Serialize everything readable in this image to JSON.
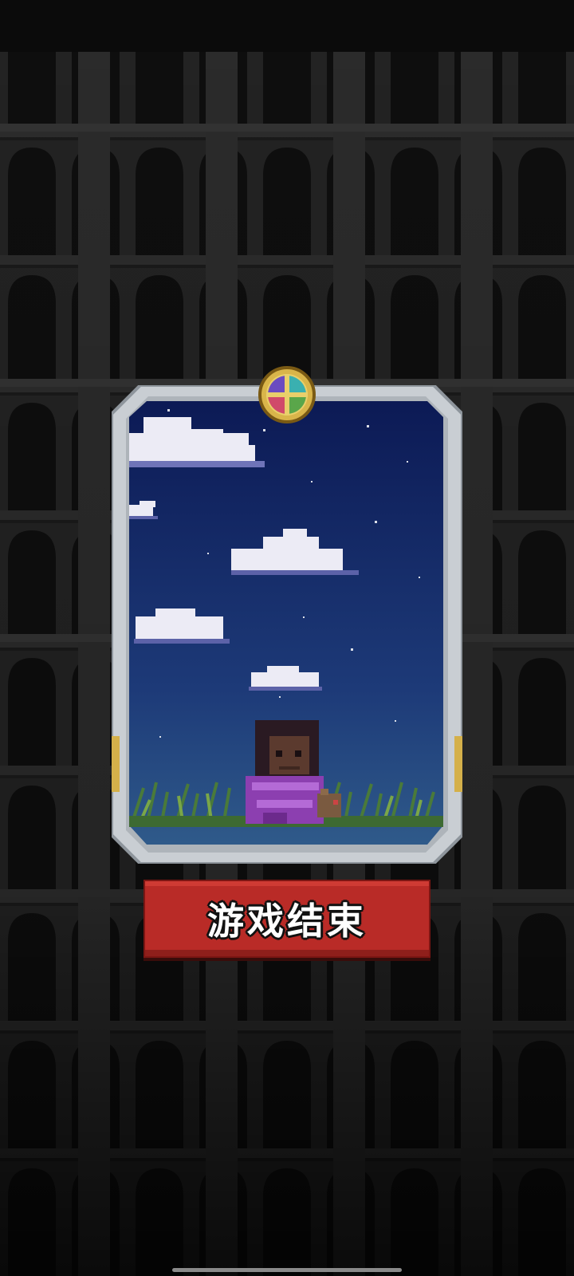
{
  "game_over_button": {
    "label": "游戏结束"
  },
  "card": {
    "character_icon": "pixel-character-in-purple-robe",
    "gem_icon": "four-color-gem-emblem"
  },
  "colors": {
    "button_red": "#b92b27",
    "frame_silver": "#c9ced3",
    "sky_top": "#0c1a55",
    "sky_bottom": "#2f5a8a",
    "background": "#141414"
  }
}
